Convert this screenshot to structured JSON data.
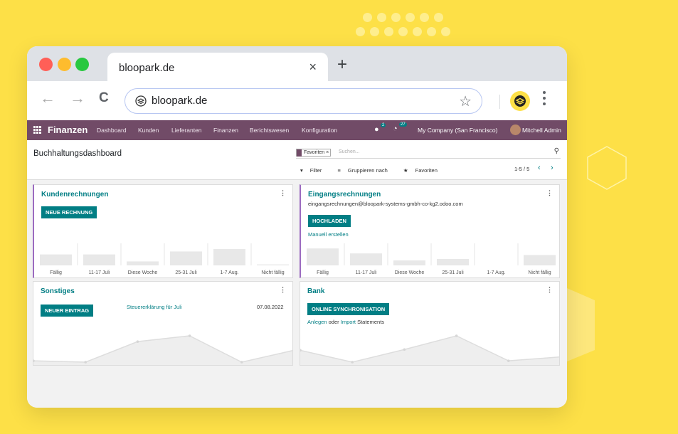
{
  "browser": {
    "tab_title": "bloopark.de",
    "tab_close": "×",
    "new_tab": "+",
    "url": "bloopark.de",
    "back": "←",
    "forward": "→",
    "reload": "C",
    "bookmark": "☆"
  },
  "odoo": {
    "app_name": "Finanzen",
    "menu": [
      "Dashboard",
      "Kunden",
      "Lieferanten",
      "Finanzen",
      "Berichtswesen",
      "Konfiguration"
    ],
    "chat_count": "2",
    "activity_count": "27",
    "company": "My Company (San Francisco)",
    "user": "Mitchell Admin",
    "brand_color": "#714b67",
    "accent_color": "#017e84"
  },
  "control": {
    "breadcrumb": "Buchhaltungsdashboard",
    "facet": "Favoriten",
    "facet_remove": "×",
    "search_placeholder": "Suchen...",
    "filter": "Filter",
    "group_by": "Gruppieren nach",
    "favorites": "Favoriten",
    "pager": "1-5 / 5"
  },
  "cards": {
    "customer_invoices": {
      "title": "Kundenrechnungen",
      "button": "NEUE RECHNUNG",
      "chart_labels": [
        "Fällig",
        "11-17 Juli",
        "Diese Woche",
        "25-31 Juli",
        "1-7 Aug.",
        "Nicht fällig"
      ],
      "bar_levels": [
        0.55,
        0.55,
        0.2,
        0.7,
        0.82,
        0.05
      ]
    },
    "vendor_bills": {
      "title": "Eingangsrechnungen",
      "email": "eingangsrechnungen@bloopark-systems-gmbh-co-kg2.odoo.com",
      "button": "HOCHLADEN",
      "manual_link": "Manuell erstellen",
      "chart_labels": [
        "Fällig",
        "11-17 Juli",
        "Diese Woche",
        "25-31 Juli",
        "1-7 Aug.",
        "Nicht fällig"
      ],
      "bar_levels": [
        0.85,
        0.6,
        0.25,
        0.32,
        0.0,
        0.52
      ]
    },
    "misc": {
      "title": "Sonstiges",
      "button": "NEUER EINTRAG",
      "item_link": "Steuererklärung für Juli",
      "item_date": "07.08.2022",
      "line_levels": [
        0.05,
        0.0,
        0.78,
        1.0,
        0.0,
        0.45
      ]
    },
    "bank": {
      "title": "Bank",
      "button": "ONLINE SYNCHRONISATION",
      "link_create": "Anlegen",
      "word_or": "oder",
      "link_import": "Import",
      "word_statements": "Statements",
      "line_levels": [
        0.45,
        0.0,
        0.48,
        1.0,
        0.05,
        0.2
      ]
    }
  }
}
